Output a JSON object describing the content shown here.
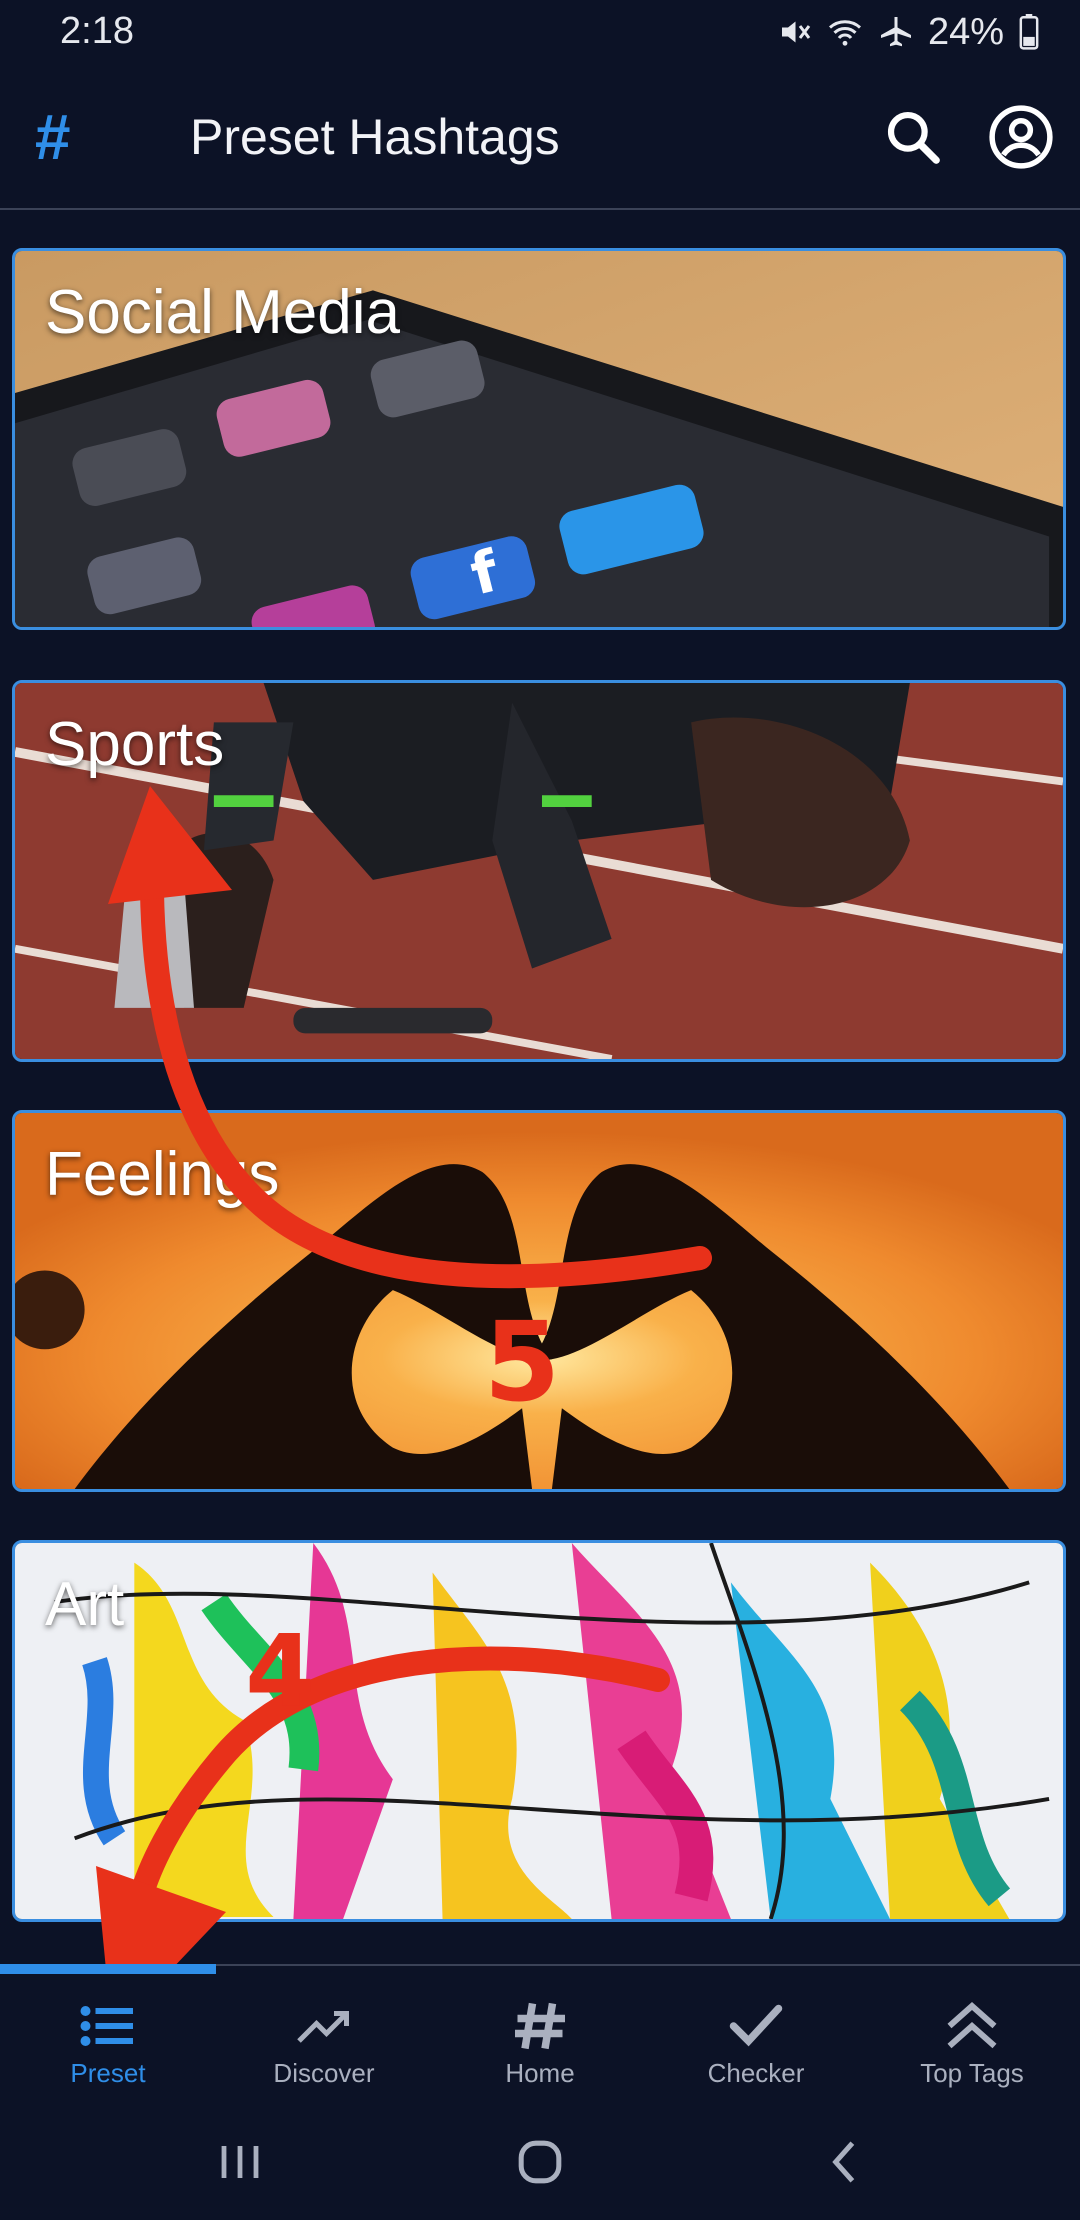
{
  "status": {
    "time": "2:18",
    "battery": "24%"
  },
  "appbar": {
    "logo": "#",
    "title": "Preset Hashtags"
  },
  "cards": [
    {
      "label": "Social Media"
    },
    {
      "label": "Sports"
    },
    {
      "label": "Feelings"
    },
    {
      "label": "Art"
    }
  ],
  "annotations": {
    "step_top": "5",
    "step_bottom": "4"
  },
  "bottom_nav": [
    {
      "label": "Preset",
      "icon": "list-icon",
      "active": true
    },
    {
      "label": "Discover",
      "icon": "trending-icon",
      "active": false
    },
    {
      "label": "Home",
      "icon": "hashtag-icon",
      "active": false
    },
    {
      "label": "Checker",
      "icon": "checkmark-icon",
      "active": false
    },
    {
      "label": "Top Tags",
      "icon": "double-chevron-up-icon",
      "active": false
    }
  ],
  "colors": {
    "background": "#0c1226",
    "accent": "#2f8ee8",
    "annotation": "#e8311a"
  }
}
